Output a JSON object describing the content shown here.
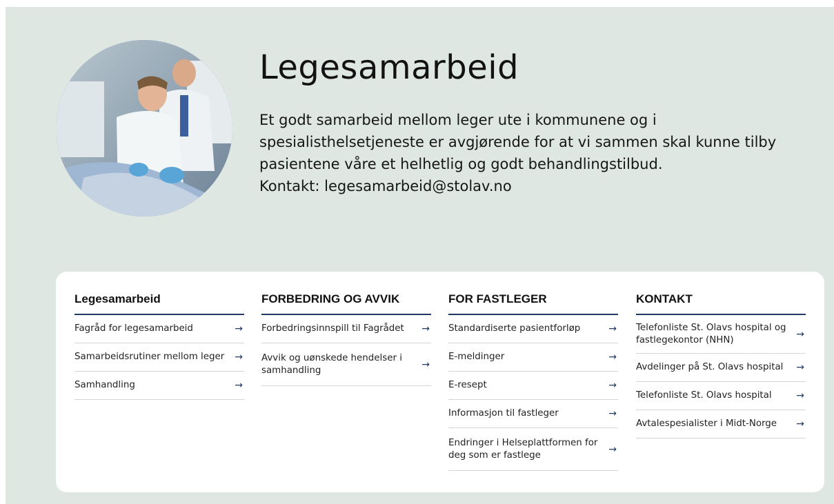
{
  "hero": {
    "title": "Legesamarbeid",
    "description_lines": [
      "Et godt samarbeid mellom leger ute i kommunene og i",
      "spesialisthelsetjeneste er avgjørende for at vi sammen skal kunne tilby",
      "pasientene våre et helhetlig og godt behandlingstilbud.",
      "Kontakt: legesamarbeid@stolav.no"
    ]
  },
  "columns": [
    {
      "title": "Legesamarbeid",
      "links": [
        {
          "label": "Fagråd for legesamarbeid",
          "arrow": "→"
        },
        {
          "label": "Samarbeidsrutiner mellom leger",
          "arrow": "→"
        },
        {
          "label": "Samhandling",
          "arrow": "→"
        }
      ]
    },
    {
      "title": "FORBEDRING OG AVVIK",
      "links": [
        {
          "label": "Forbedringsinnspill til Fagrådet",
          "arrow": "→"
        },
        {
          "label": "Avvik og uønskede hendelser i samhandling",
          "arrow": "→"
        }
      ]
    },
    {
      "title": "FOR FASTLEGER",
      "links": [
        {
          "label": "Standardiserte pasientforløp",
          "arrow": "→"
        },
        {
          "label": "E-meldinger",
          "arrow": "→"
        },
        {
          "label": "E-resept",
          "arrow": "→"
        },
        {
          "label": "Informasjon til fastleger",
          "arrow": "→"
        },
        {
          "label": "Endringer i Helseplattformen for deg som er fastlege",
          "arrow": "→"
        }
      ]
    },
    {
      "title": "KONTAKT",
      "links": [
        {
          "label": "Telefonliste St. Olavs hospital og fastlegekontor (NHN)",
          "arrow": "→"
        },
        {
          "label": "Avdelinger på St. Olavs hospital",
          "arrow": "→"
        },
        {
          "label": "Telefonliste St. Olavs hospital",
          "arrow": "→"
        },
        {
          "label": "Avtalespesialister i Midt-Norge",
          "arrow": "→"
        }
      ]
    }
  ],
  "colors": {
    "background": "#dfe7e3",
    "card": "#ffffff",
    "accent_navy": "#1f3864"
  }
}
